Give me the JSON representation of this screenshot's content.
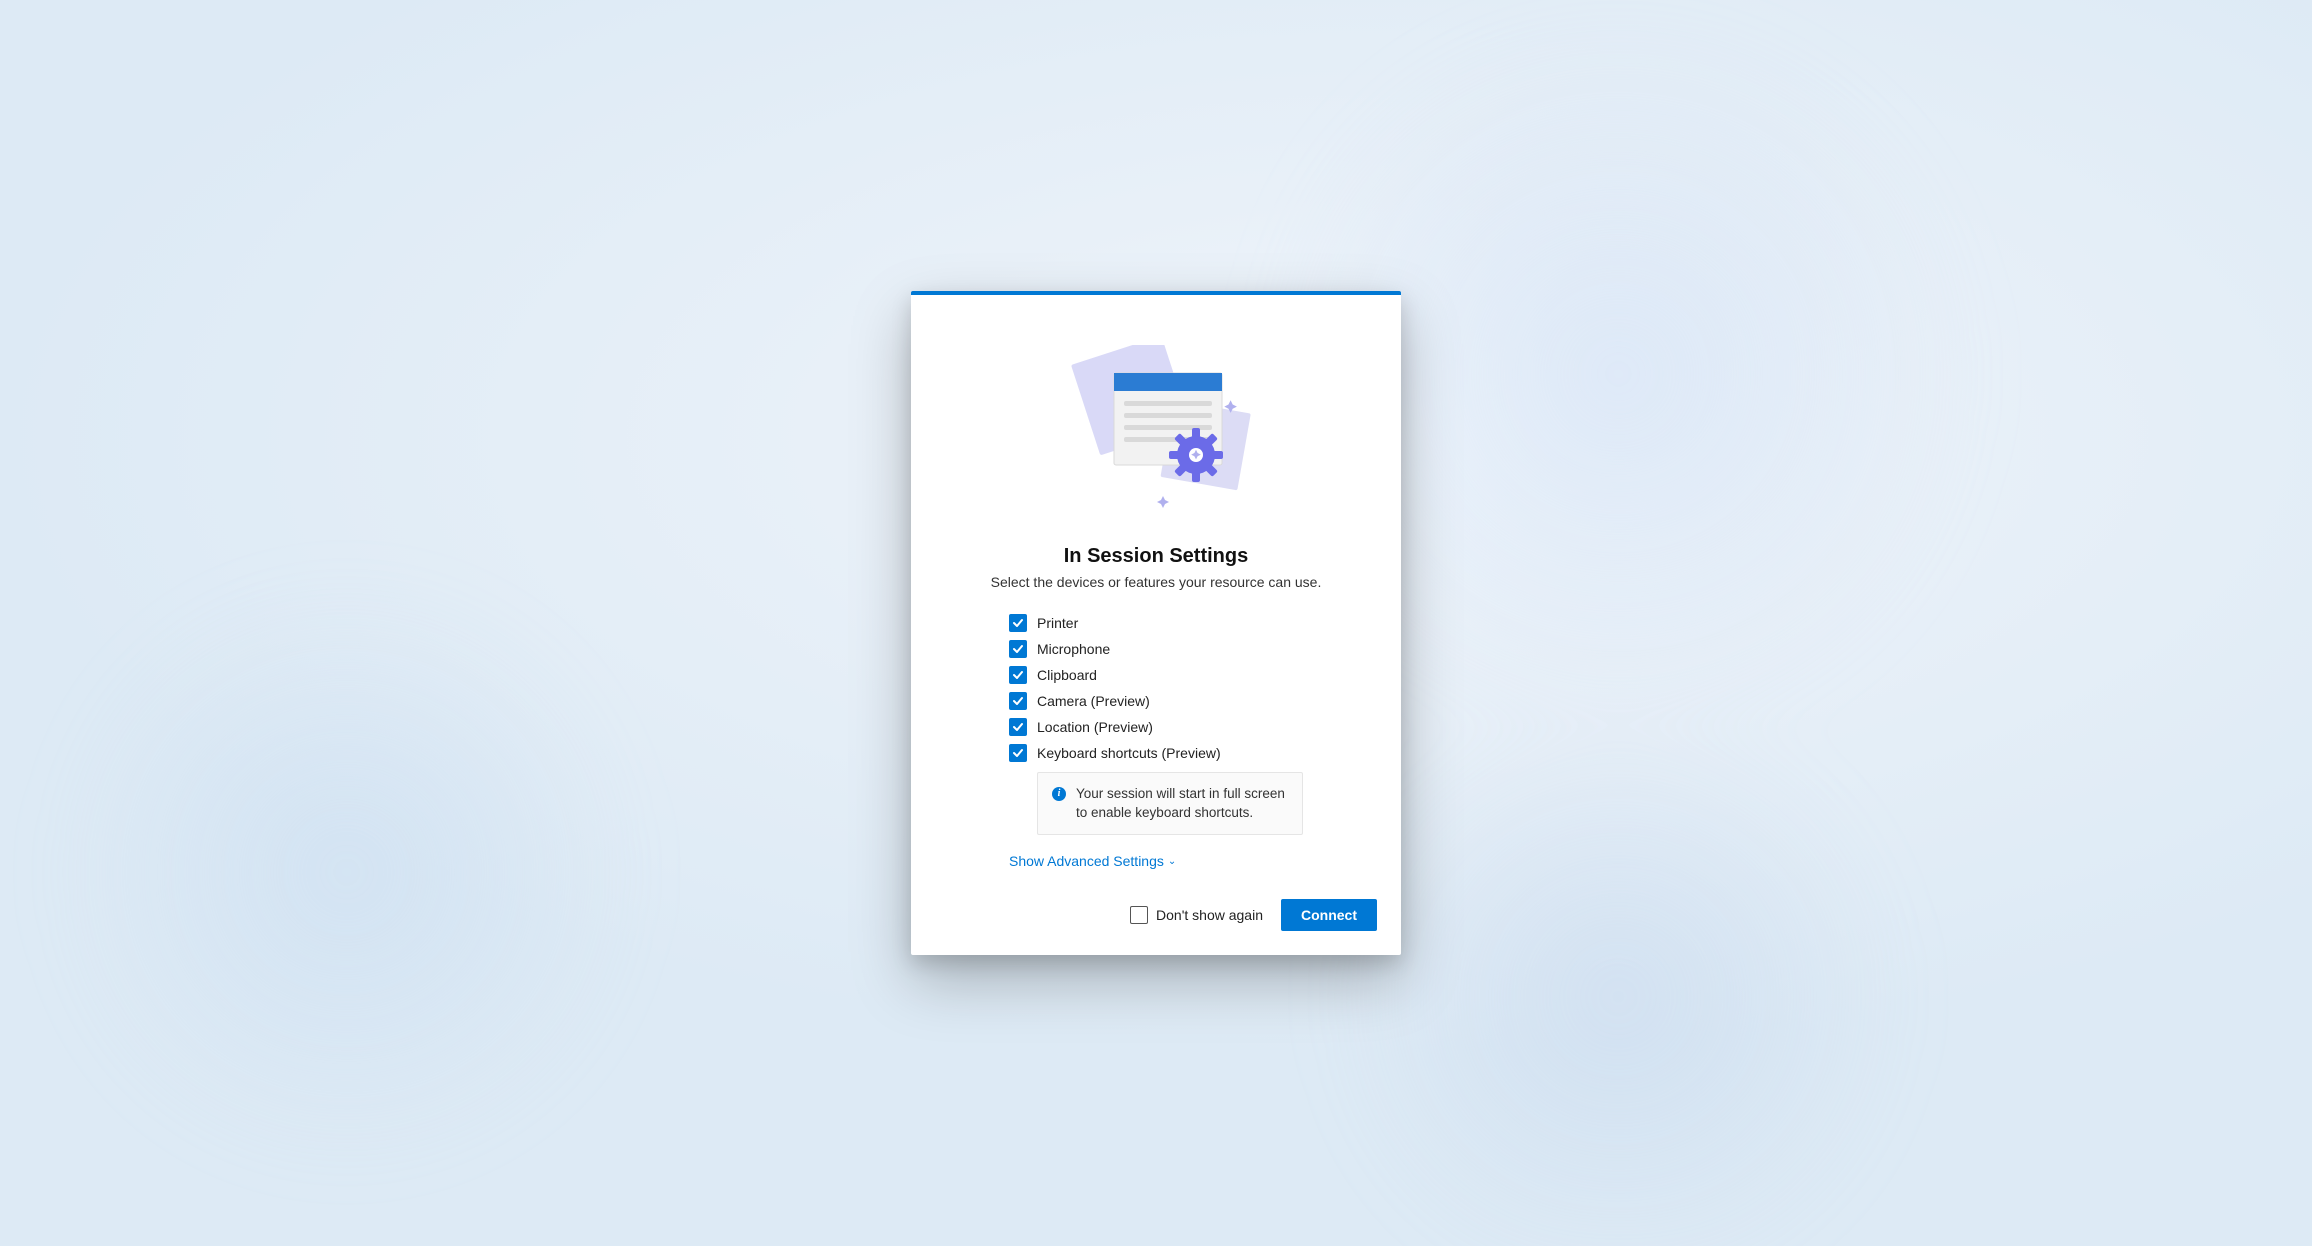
{
  "dialog": {
    "title": "In Session Settings",
    "subtitle": "Select the devices or features your resource can use.",
    "options": [
      {
        "label": "Printer",
        "checked": true
      },
      {
        "label": "Microphone",
        "checked": true
      },
      {
        "label": "Clipboard",
        "checked": true
      },
      {
        "label": "Camera (Preview)",
        "checked": true
      },
      {
        "label": "Location (Preview)",
        "checked": true
      },
      {
        "label": "Keyboard shortcuts (Preview)",
        "checked": true
      }
    ],
    "info_message": "Your session will start in full screen to enable keyboard shortcuts.",
    "advanced_link": "Show Advanced Settings",
    "dont_show_again": {
      "label": "Don't show again",
      "checked": false
    },
    "connect_button": "Connect"
  },
  "colors": {
    "accent": "#0078d4"
  }
}
